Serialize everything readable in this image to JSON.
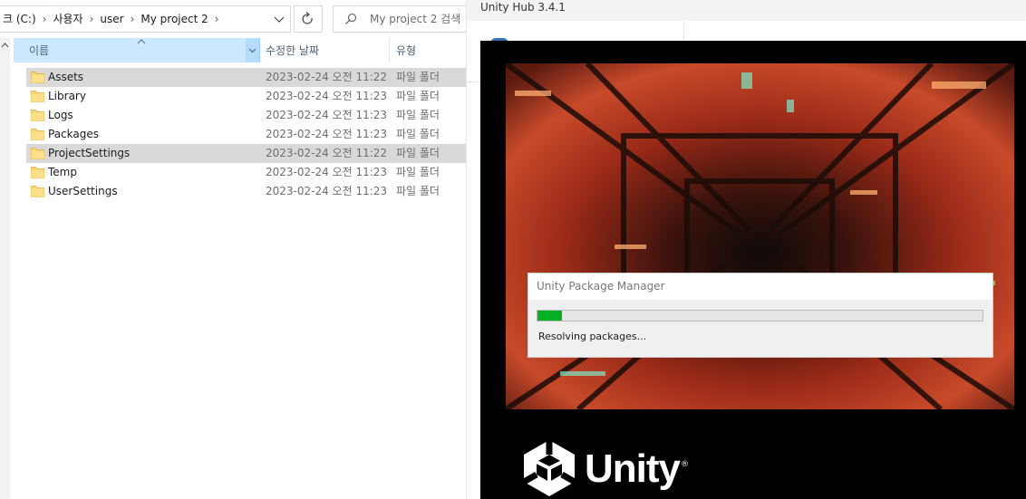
{
  "explorer": {
    "breadcrumbs": [
      "크 (C:)",
      "사용자",
      "user",
      "My project 2"
    ],
    "search_placeholder": "My project 2 검색",
    "columns": {
      "name": "이름",
      "date": "수정한 날짜",
      "type": "유형"
    },
    "files": [
      {
        "name": "Assets",
        "date": "2023-02-24 오전 11:22",
        "type": "파일 폴더",
        "selected": true
      },
      {
        "name": "Library",
        "date": "2023-02-24 오전 11:23",
        "type": "파일 폴더",
        "selected": false
      },
      {
        "name": "Logs",
        "date": "2023-02-24 오전 11:23",
        "type": "파일 폴더",
        "selected": false
      },
      {
        "name": "Packages",
        "date": "2023-02-24 오전 11:23",
        "type": "파일 폴더",
        "selected": false
      },
      {
        "name": "ProjectSettings",
        "date": "2023-02-24 오전 11:22",
        "type": "파일 폴더",
        "selected": true
      },
      {
        "name": "Temp",
        "date": "2023-02-24 오전 11:23",
        "type": "파일 폴더",
        "selected": false
      },
      {
        "name": "UserSettings",
        "date": "2023-02-24 오전 11:23",
        "type": "파일 폴더",
        "selected": false
      }
    ]
  },
  "hub": {
    "title": "Unity Hub 3.4.1",
    "package_manager": {
      "title": "Unity Package Manager",
      "status": "Resolving packages...",
      "progress_fraction": 0.055,
      "progress_color": "#06b025"
    },
    "logo_text": "Unity",
    "logo_mark": "®"
  }
}
